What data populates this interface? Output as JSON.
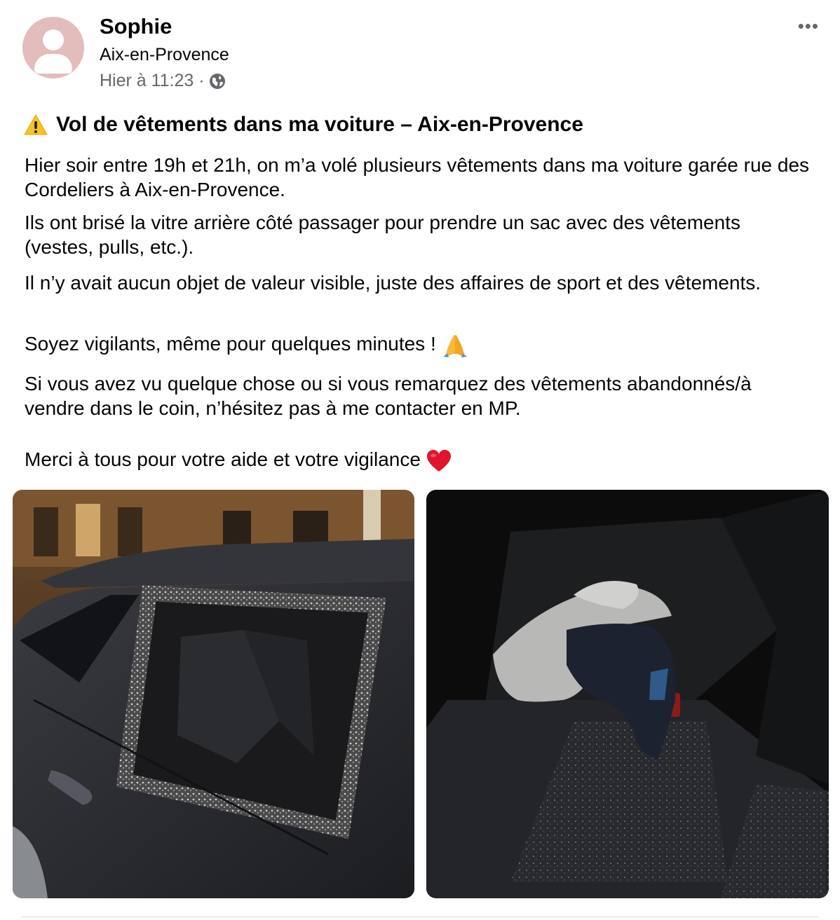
{
  "post": {
    "author": "Sophie",
    "location": "Aix-en-Provence",
    "timestamp": "Hier à 11:23 ·",
    "audience_icon": "globe-icon",
    "more_label": "•••",
    "title": "Vol de vêtements dans ma voiture – Aix-en-Provence",
    "title_icon": "warning-icon",
    "paragraphs": [
      "Hier soir entre 19h et 21h, on m’a volé plusieurs vêtements dans ma voiture garée rue des Cordeliers à Aix-en-Provence.",
      "Ils ont brisé la vitre arrière côté passager pour prendre un sac avec des vêtements (vestes, pulls, etc.).",
      "Il n’y avait aucun objet de valeur visible, juste des affaires de sport et des vêtements.",
      "Soyez vigilants, même pour quelques minutes !",
      "Si vous avez vu quelque chose ou si vous remarquez des vêtements abandonnés/à vendre dans le coin, n’hésitez pas à me contacter en MP.",
      "Merci à tous pour votre aide et votre vigilance"
    ],
    "paragraph_emojis": {
      "p4": "praying-hands-icon",
      "p6": "red-heart-icon"
    },
    "photos": [
      "car-broken-window-photo",
      "car-back-seat-photo"
    ]
  },
  "colors": {
    "text": "#050505",
    "secondary": "#65676b",
    "avatar_bg": "#e3bcbc"
  }
}
